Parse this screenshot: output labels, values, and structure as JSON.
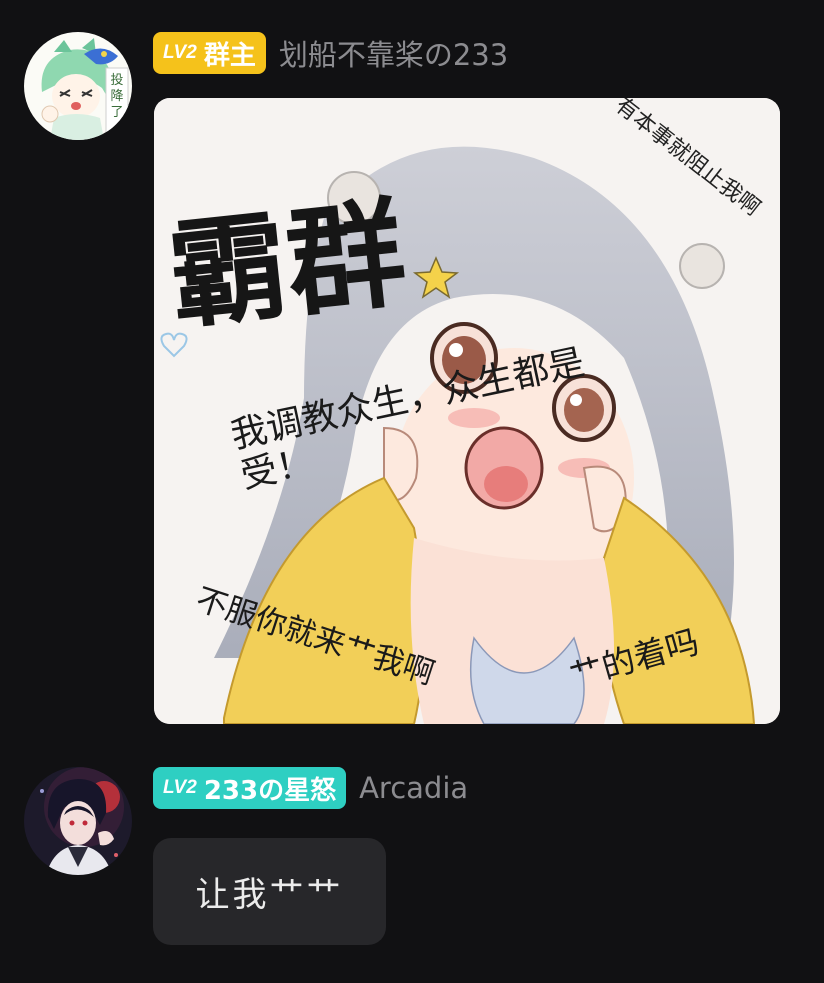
{
  "messages": [
    {
      "avatar_icon": "chibi-girl-avatar-icon",
      "avatar_sign": "投降了",
      "level": "LV2",
      "role": "群主",
      "badge_color": "#f5c21b",
      "nickname": "划船不靠桨の233",
      "sticker": {
        "title": "霸群",
        "corner_text": "有本事就阻止我啊",
        "line1": "我调教众生，众生都是",
        "line2": "受！",
        "bottom_left": "不服你就来艹我啊",
        "bottom_right": "艹的着吗"
      }
    },
    {
      "avatar_icon": "dark-anime-boy-avatar-icon",
      "level": "LV2",
      "role": "233の星怒",
      "badge_color": "#2ecfc2",
      "nickname": "Arcadia",
      "text": "让我艹艹"
    }
  ]
}
